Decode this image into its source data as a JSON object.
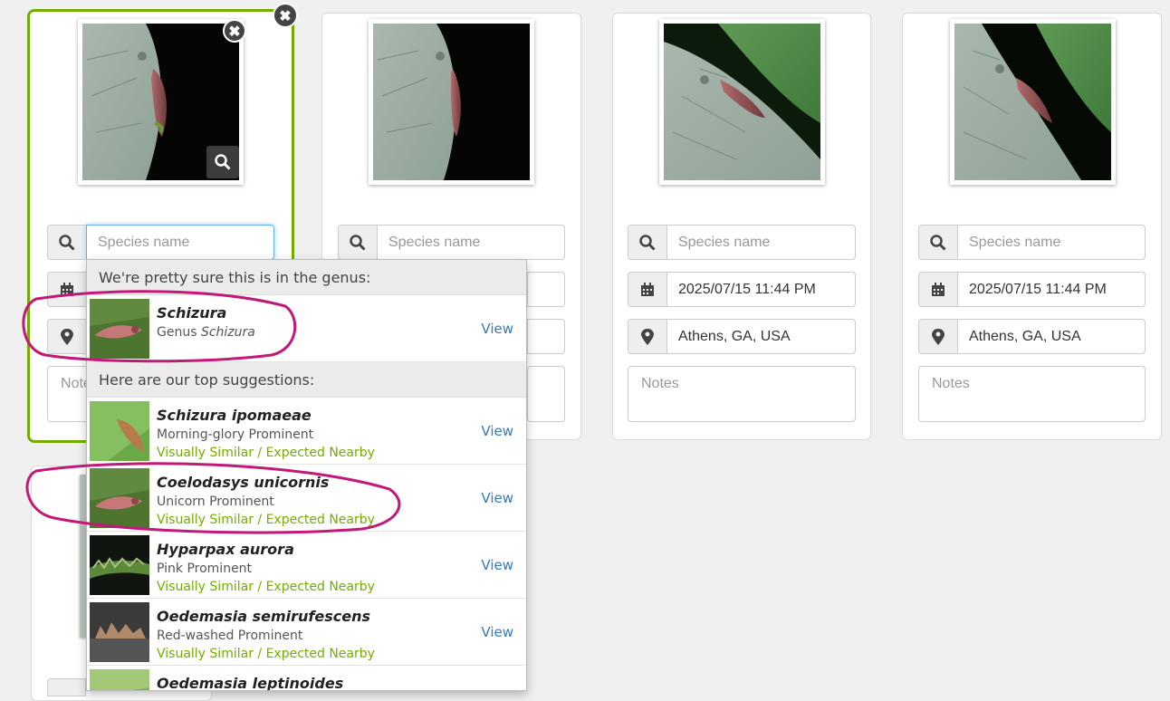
{
  "cards": [
    {
      "species_placeholder": "Species name",
      "datetime": "",
      "location": "",
      "notes_placeholder": "Notes"
    },
    {
      "species_placeholder": "Species name",
      "datetime": "",
      "location": "",
      "notes_placeholder": ""
    },
    {
      "species_placeholder": "Species name",
      "datetime": "2025/07/15 11:44 PM",
      "location": "Athens, GA, USA",
      "notes_placeholder": "Notes"
    },
    {
      "species_placeholder": "Species name",
      "datetime": "2025/07/15 11:44 PM",
      "location": "Athens, GA, USA",
      "notes_placeholder": "Notes"
    }
  ],
  "selected_card_notes_partial": "Note",
  "close_glyph": "✖",
  "dropdown": {
    "genus_header": "We're pretty sure this is in the genus:",
    "genus": {
      "sci": "Schizura",
      "common_prefix": "Genus ",
      "common_italic": "Schizura",
      "view": "View"
    },
    "suggestions_header": "Here are our top suggestions:",
    "suggestions": [
      {
        "sci": "Schizura ipomaeae",
        "common": "Morning-glory Prominent",
        "tags": "Visually Similar / Expected Nearby",
        "view": "View"
      },
      {
        "sci": "Coelodasys unicornis",
        "common": "Unicorn Prominent",
        "tags": "Visually Similar / Expected Nearby",
        "view": "View"
      },
      {
        "sci": "Hyparpax aurora",
        "common": "Pink Prominent",
        "tags": "Visually Similar / Expected Nearby",
        "view": "View"
      },
      {
        "sci": "Oedemasia semirufescens",
        "common": "Red-washed Prominent",
        "tags": "Visually Similar / Expected Nearby",
        "view": "View"
      },
      {
        "sci": "Oedemasia leptinoides",
        "common": "",
        "tags": "",
        "view": ""
      }
    ]
  },
  "colors": {
    "accent_green": "#74ac00",
    "link_blue": "#337ab7",
    "annotation_magenta": "#c2187a"
  }
}
